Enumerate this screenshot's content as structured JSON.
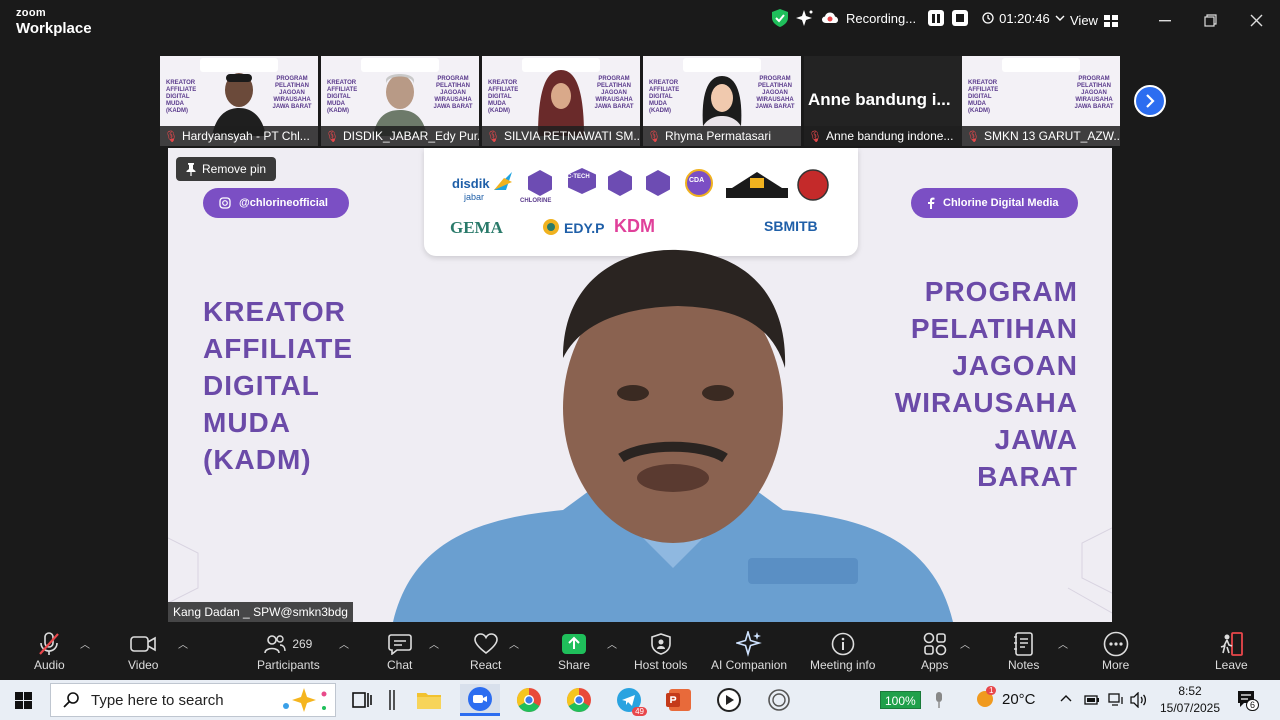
{
  "app": {
    "brand_top": "zoom",
    "brand_bottom": "Workplace"
  },
  "topbar": {
    "recording_label": "Recording...",
    "timer": "01:20:46",
    "view_label": "View"
  },
  "colors": {
    "accent": "#7b4fc4",
    "record_red": "#e8474b",
    "zoom_blue": "#2c6df0",
    "shield_green": "#1fbf5b"
  },
  "gallery": [
    {
      "name": "Hardyansyah - PT Chl...",
      "muted": true,
      "video": true
    },
    {
      "name": "DISDIK_JABAR_Edy Pur...",
      "muted": true,
      "video": true
    },
    {
      "name": "SILVIA RETNAWATI SM...",
      "muted": true,
      "video": true
    },
    {
      "name": "Rhyma Permatasari",
      "muted": true,
      "video": true
    },
    {
      "name": "Anne bandung indone...",
      "muted": true,
      "video": false,
      "big_name": "Anne bandung i..."
    },
    {
      "name": "SMKN 13 GARUT_AZW...",
      "muted": true,
      "video": false
    }
  ],
  "tile_slide": {
    "left": "KREATOR AFFILIATE DIGITAL MUDA (KADM)",
    "right": "PROGRAM PELATIHAN JAGOAN WIRAUSAHA JAWA BARAT"
  },
  "main": {
    "remove_pin": "Remove pin",
    "instagram": "@chlorineofficial",
    "facebook": "Chlorine Digital Media",
    "left_title": [
      "KREATOR",
      "AFFILIATE",
      "DIGITAL",
      "MUDA",
      "(KADM)"
    ],
    "right_title": [
      "PROGRAM",
      "PELATIHAN",
      "JAGOAN",
      "WIRAUSAHA",
      "JAWA",
      "BARAT"
    ],
    "logos": {
      "disdik": "disdik",
      "jabar": "jabar",
      "chlorine": "CHLORINE",
      "ctech": "C-TECH",
      "cda": "CDA",
      "gema": "GEMA",
      "edyp": "EDY.P",
      "kdm": "KDM",
      "sbmitb": "SBMITB"
    },
    "speaker_name": "Kang Dadan _ SPW@smkn3bdg"
  },
  "toolbar": {
    "audio": "Audio",
    "video": "Video",
    "participants": "Participants",
    "participants_count": "269",
    "chat": "Chat",
    "react": "React",
    "share": "Share",
    "host_tools": "Host tools",
    "ai_companion": "AI Companion",
    "meeting_info": "Meeting info",
    "apps": "Apps",
    "notes": "Notes",
    "more": "More",
    "leave": "Leave"
  },
  "taskbar": {
    "search_placeholder": "Type here to search",
    "telegram_badge": "49",
    "battery": "100%",
    "weather": "20°C",
    "weather_badge": "1",
    "time": "8:52",
    "date": "15/07/2025",
    "notif_count": "6"
  }
}
